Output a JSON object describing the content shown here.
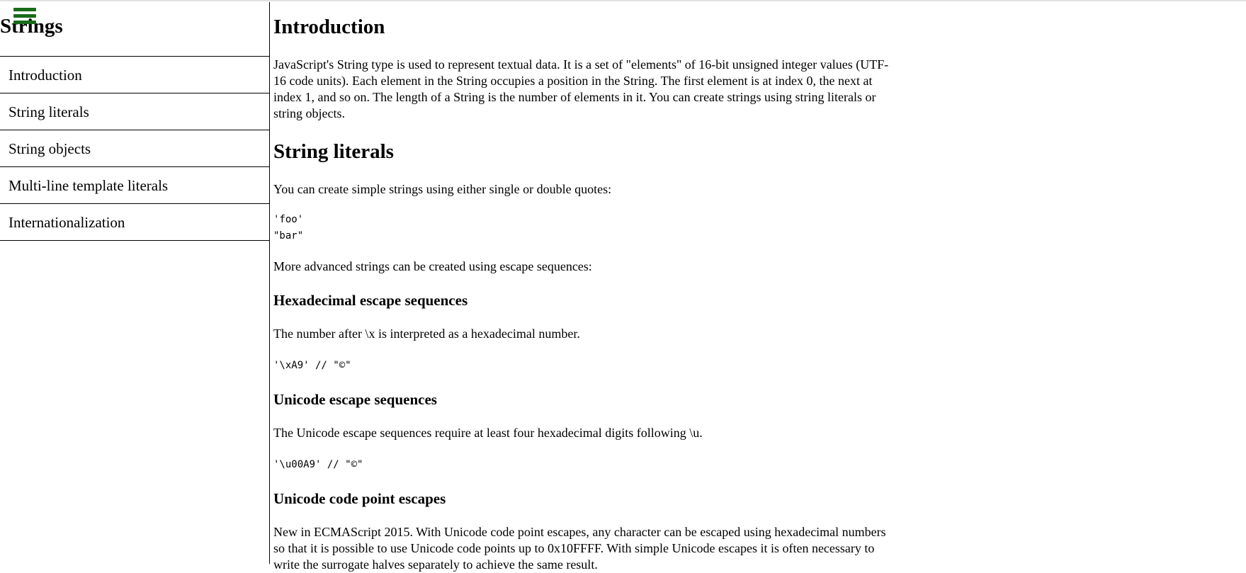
{
  "sidebar": {
    "title": "Strings",
    "menu_icon": "hamburger-menu-icon",
    "menu_icon_color": "#1a6b1a",
    "items": [
      {
        "label": "Introduction"
      },
      {
        "label": "String literals"
      },
      {
        "label": "String objects"
      },
      {
        "label": "Multi-line template literals"
      },
      {
        "label": "Internationalization"
      }
    ]
  },
  "main": {
    "intro_heading": "Introduction",
    "intro_text": "JavaScript's String type is used to represent textual data. It is a set of \"elements\" of 16-bit unsigned integer values (UTF-16 code units). Each element in the String occupies a position in the String. The first element is at index 0, the next at index 1, and so on. The length of a String is the number of elements in it. You can create strings using string literals or string objects.",
    "literals_heading": "String literals",
    "literals_text": "You can create simple strings using either single or double quotes:",
    "literals_code": "'foo'\n\"bar\"",
    "advanced_text": "More advanced strings can be created using escape sequences:",
    "hex_heading": "Hexadecimal escape sequences",
    "hex_text": "The number after \\x is interpreted as a hexadecimal number.",
    "hex_code": "'\\xA9' // \"©\"",
    "unicode_heading": "Unicode escape sequences",
    "unicode_text": "The Unicode escape sequences require at least four hexadecimal digits following \\u.",
    "unicode_code": "'\\u00A9' // \"©\"",
    "codepoint_heading": "Unicode code point escapes",
    "codepoint_text": "New in ECMAScript 2015. With Unicode code point escapes, any character can be escaped using hexadecimal numbers so that it is possible to use Unicode code points up to 0x10FFFF. With simple Unicode escapes it is often necessary to write the surrogate halves separately to achieve the same result."
  }
}
